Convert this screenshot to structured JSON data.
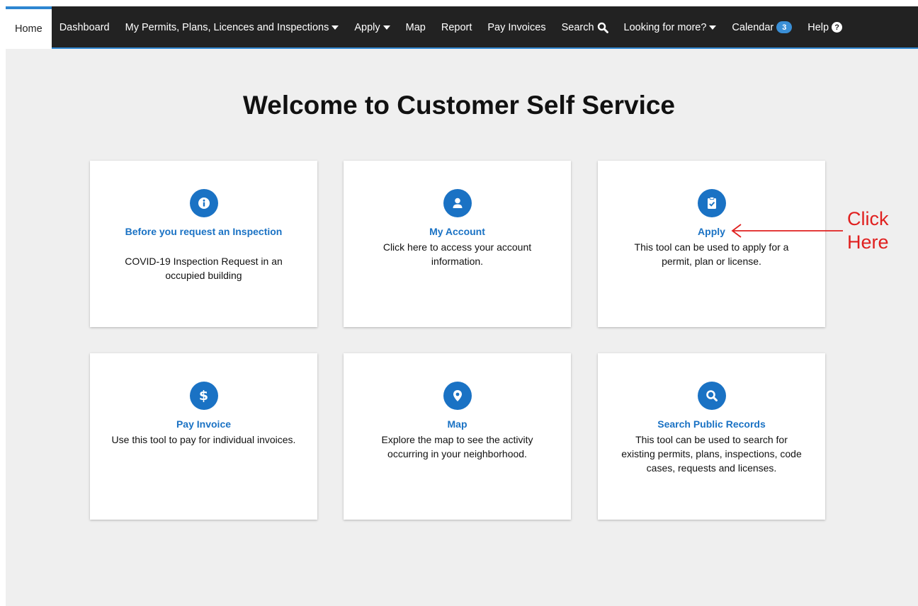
{
  "nav": {
    "items": [
      {
        "label": "Home"
      },
      {
        "label": "Dashboard"
      },
      {
        "label": "My Permits, Plans, Licences and Inspections"
      },
      {
        "label": "Apply"
      },
      {
        "label": "Map"
      },
      {
        "label": "Report"
      },
      {
        "label": "Pay Invoices"
      },
      {
        "label": "Search"
      },
      {
        "label": "Looking for more?"
      },
      {
        "label": "Calendar"
      },
      {
        "label": "Help"
      }
    ],
    "calendar_badge": "3",
    "help_glyph": "?"
  },
  "page": {
    "title": "Welcome to Customer Self Service"
  },
  "cards": [
    {
      "title": "Before you request an Inspection",
      "description": "COVID-19 Inspection Request in an occupied building",
      "icon": "info-icon"
    },
    {
      "title": "My Account",
      "description": "Click here to access your account information.",
      "icon": "user-icon"
    },
    {
      "title": "Apply",
      "description": "This tool can be used to apply for a permit, plan or license.",
      "icon": "clipboard-check-icon"
    },
    {
      "title": "Pay Invoice",
      "description": "Use this tool to pay for individual invoices.",
      "icon": "dollar-icon"
    },
    {
      "title": "Map",
      "description": "Explore the map to see the activity occurring in your neighborhood.",
      "icon": "map-pin-icon"
    },
    {
      "title": "Search Public Records",
      "description": "This tool can be used to search for existing permits, plans, inspections, code cases, requests and licenses.",
      "icon": "search-icon"
    }
  ],
  "annotation": {
    "line1": "Click",
    "line2": "Here"
  },
  "colors": {
    "navbar_bg": "#222222",
    "accent": "#1a72c4",
    "annotation": "#e0201f",
    "content_bg": "#efefef"
  }
}
